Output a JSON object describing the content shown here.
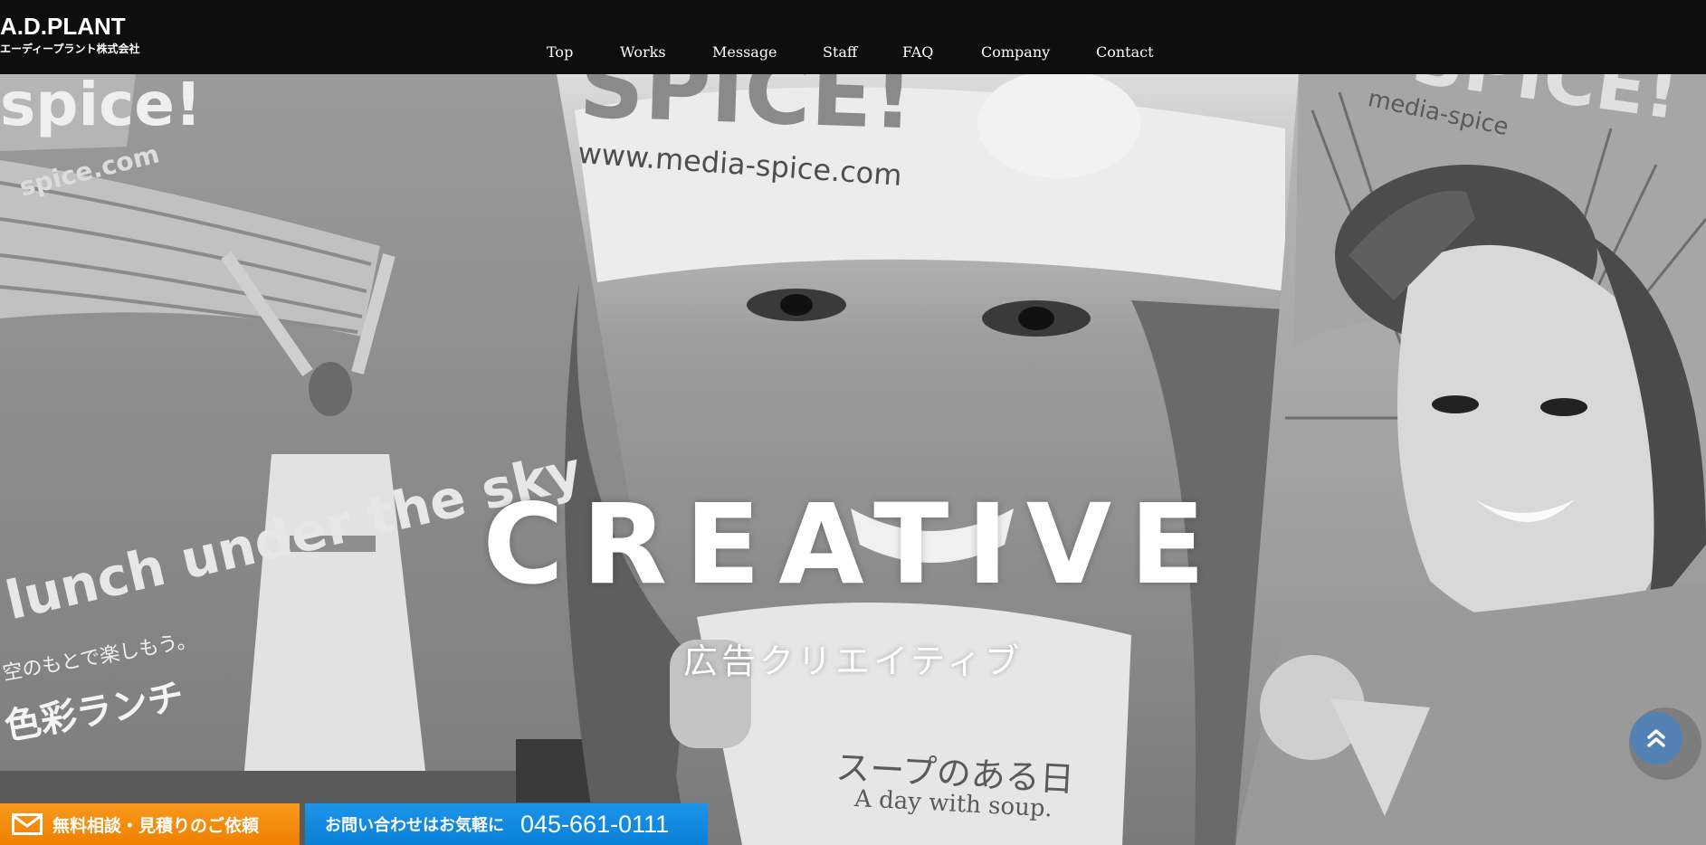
{
  "header": {
    "logo_main": "A.D.PLANT",
    "logo_sub": "エーディープラント株式会社",
    "nav": [
      "Top",
      "Works",
      "Message",
      "Staff",
      "FAQ",
      "Company",
      "Contact"
    ]
  },
  "hero": {
    "title": "CREATIVE",
    "subtitle": "広告クリエイティブ",
    "posters": {
      "left_brand": "spice!",
      "left_url": "spice.com",
      "left_headline": "lunch under the sky",
      "left_jp_line1": "空のもとで楽しもう。",
      "left_jp_line2": "色彩ランチ",
      "center_brand": "SPICE!",
      "center_url": "www.media-spice.com",
      "center_cup_jp": "スープのある日",
      "center_cup_en": "A day with soup.",
      "right_brand": "SPICE!",
      "right_url": "media-spice"
    }
  },
  "cta": {
    "consult_label": "無料相談・見積りのご依頼",
    "phone_lead": "お問い合わせはお気軽に",
    "phone_number": "045-661-0111"
  },
  "icons": {
    "consult": "mail-icon",
    "scroll_top": "double-chevron-up-icon"
  },
  "colors": {
    "header_bg": "#0e0e0e",
    "consult_bg": "#f08000",
    "phone_bg": "#0a7fd6",
    "scroll_top_bg": "#4682c8"
  }
}
